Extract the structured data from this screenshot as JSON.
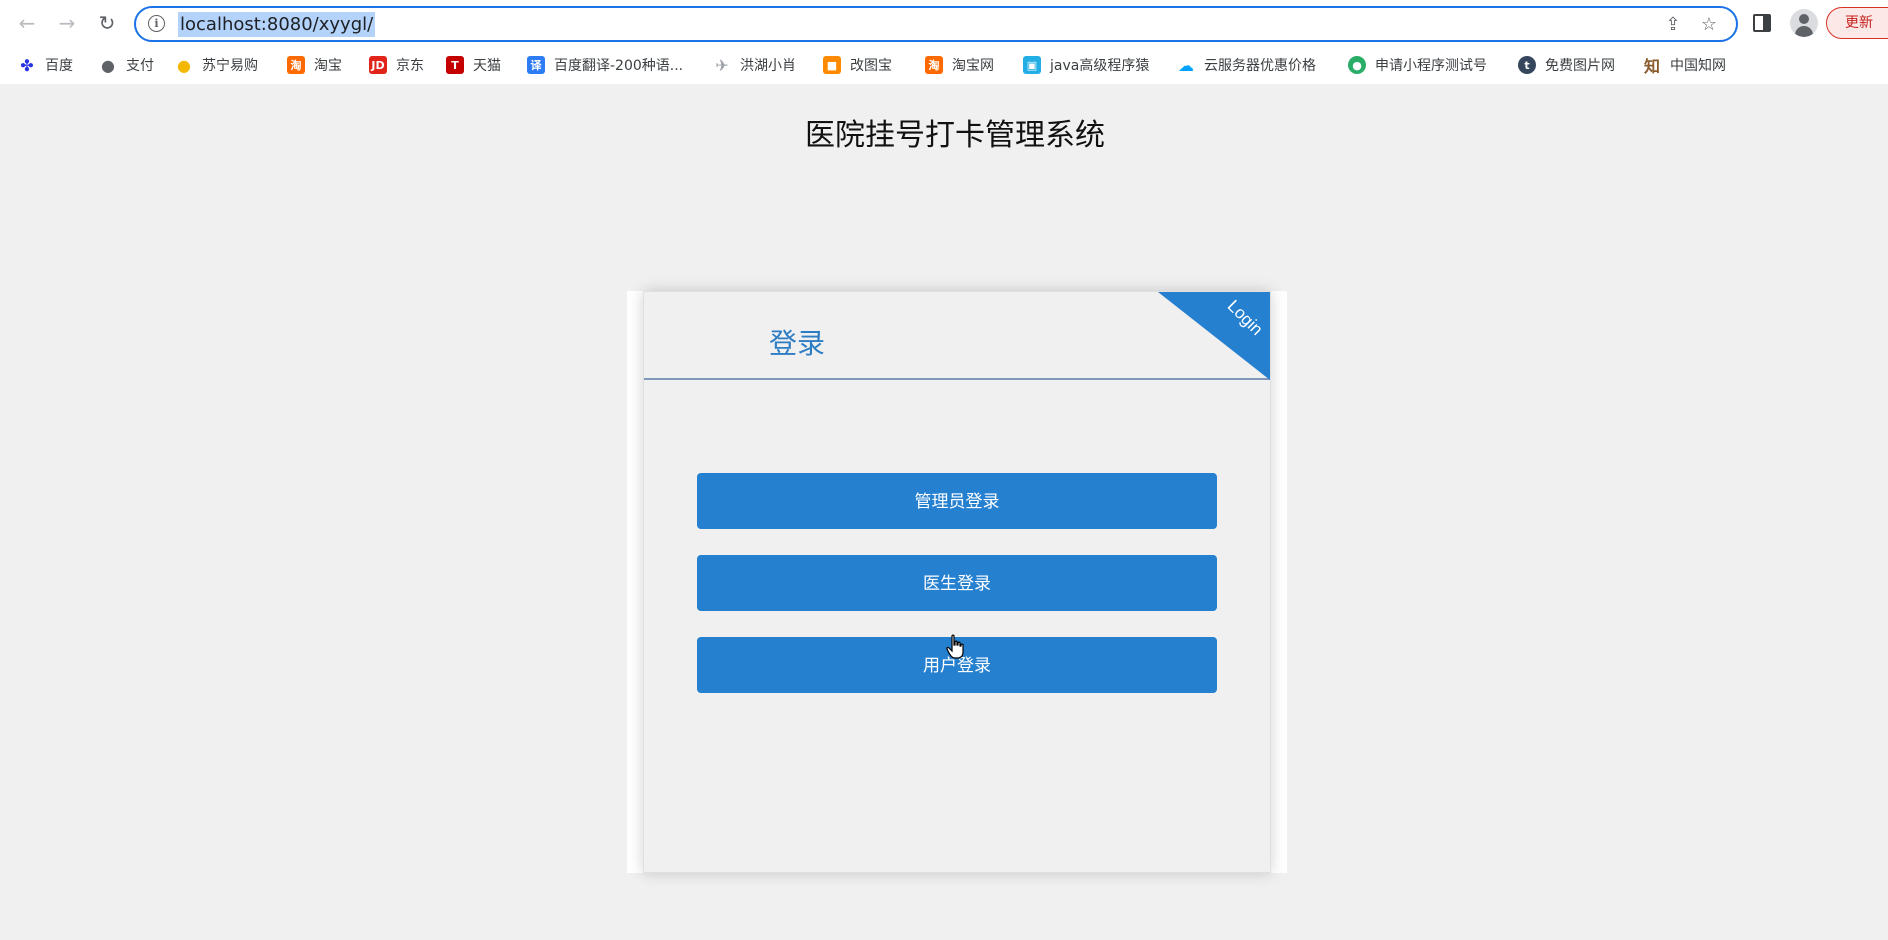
{
  "browser": {
    "url": "localhost:8080/xyygl/",
    "info_icon": "i",
    "update_label": "更新"
  },
  "bookmarks": [
    {
      "label": "百度",
      "icon": "baidu-paw-icon",
      "glyph": "✤",
      "color": "#2932e1"
    },
    {
      "label": "支付",
      "icon": "globe-icon",
      "glyph": "●",
      "color": "#5f6368"
    },
    {
      "label": "苏宁易购",
      "icon": "suning-lion-icon",
      "glyph": "●",
      "color": "#f5b800"
    },
    {
      "label": "淘宝",
      "icon": "taobao-icon",
      "glyph": "淘",
      "color": "#ff6a00"
    },
    {
      "label": "京东",
      "icon": "jd-icon",
      "glyph": "JD",
      "color": "#e1251b"
    },
    {
      "label": "天猫",
      "icon": "tmall-icon",
      "glyph": "T",
      "color": "#c40000"
    },
    {
      "label": "百度翻译-200种语...",
      "icon": "translate-icon",
      "glyph": "译",
      "color": "#2d7cf6"
    },
    {
      "label": "洪湖小肖",
      "icon": "rocket-icon",
      "glyph": "✈",
      "color": "#9aa0a6"
    },
    {
      "label": "改图宝",
      "icon": "gaitubao-icon",
      "glyph": "■",
      "color": "#ff8a00"
    },
    {
      "label": "淘宝网",
      "icon": "taobao-net-icon",
      "glyph": "淘",
      "color": "#ff6a00"
    },
    {
      "label": "java高级程序猿",
      "icon": "bilibili-tv-icon",
      "glyph": "▣",
      "color": "#23ade5"
    },
    {
      "label": "云服务器优惠价格",
      "icon": "cloud-icon",
      "glyph": "☁",
      "color": "#00a3ff"
    },
    {
      "label": "申请小程序测试号",
      "icon": "wechat-icon",
      "glyph": "●",
      "color": "#2aae67"
    },
    {
      "label": "免费图片网",
      "icon": "tumblr-icon",
      "glyph": "t",
      "color": "#36465d"
    },
    {
      "label": "中国知网",
      "icon": "cnki-icon",
      "glyph": "知",
      "color": "#8a5a2b"
    }
  ],
  "page": {
    "title": "医院挂号打卡管理系统"
  },
  "login_card": {
    "heading": "登录",
    "ribbon": "Login",
    "buttons": [
      {
        "label": "管理员登录"
      },
      {
        "label": "医生登录"
      },
      {
        "label": "用户登录"
      }
    ]
  }
}
